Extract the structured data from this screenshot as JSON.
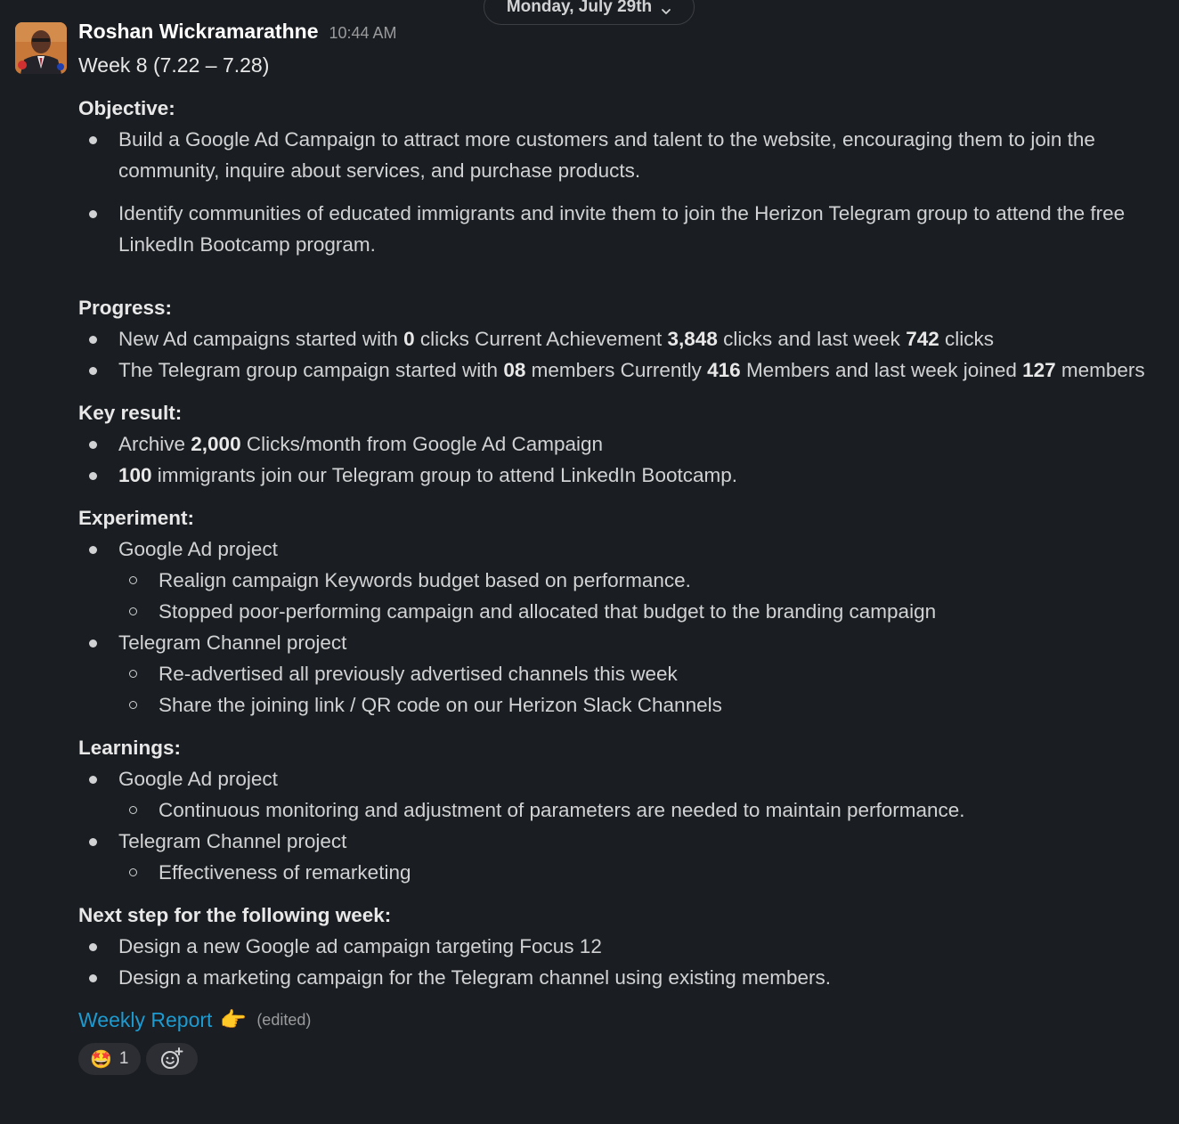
{
  "date_divider": {
    "label": "Monday, July 29th",
    "icon": "chevron-down-icon"
  },
  "message": {
    "sender": "Roshan Wickramarathne",
    "time": "10:44 AM",
    "title": "Week 8 (7.22 – 7.28)",
    "sections": {
      "objective": {
        "heading": "Objective:",
        "items": [
          "Build a Google Ad Campaign to attract more customers and talent to the website, encouraging them to join the community, inquire about services, and purchase products.",
          "Identify communities of educated immigrants and invite them to join the Herizon Telegram group to attend the free LinkedIn Bootcamp program."
        ]
      },
      "progress": {
        "heading": "Progress:",
        "item1": {
          "t1": "New Ad campaigns started with ",
          "b1": "0",
          "t2": " clicks Current Achievement ",
          "b2": "3,848",
          "t3": " clicks and last week ",
          "b3": "742",
          "t4": " clicks"
        },
        "item2": {
          "t1": "The Telegram group campaign started with ",
          "b1": "08",
          "t2": " members Currently ",
          "b2": "416",
          "t3": " Members and last week joined ",
          "b3": "127",
          "t4": " members"
        }
      },
      "key_result": {
        "heading": "Key result:",
        "item1": {
          "t1": "Archive ",
          "b1": "2,000",
          "t2": " Clicks/month from Google Ad Campaign"
        },
        "item2": {
          "b1": "100",
          "t1": " immigrants join our Telegram group to attend LinkedIn Bootcamp."
        }
      },
      "experiment": {
        "heading": "Experiment:",
        "groups": [
          {
            "label": "Google Ad project",
            "subitems": [
              "Realign campaign Keywords budget based on performance.",
              "Stopped poor-performing campaign and allocated that budget to the branding campaign"
            ]
          },
          {
            "label": "Telegram Channel project",
            "subitems": [
              "Re-advertised all previously advertised channels this week",
              "Share the joining link / QR code on our Herizon Slack Channels"
            ]
          }
        ]
      },
      "learnings": {
        "heading": "Learnings:",
        "groups": [
          {
            "label": "Google Ad project",
            "subitems": [
              "Continuous monitoring and adjustment of parameters are needed to maintain performance."
            ]
          },
          {
            "label": "Telegram Channel project",
            "subitems": [
              "Effectiveness of remarketing"
            ]
          }
        ]
      },
      "next_step": {
        "heading": "Next step for the following week:",
        "items": [
          "Design a new Google ad campaign targeting Focus 12",
          "Design a marketing campaign for the Telegram channel using existing members."
        ]
      }
    },
    "footer": {
      "link_text": "Weekly Report",
      "pointing_emoji": "👈",
      "edited_label": "(edited)"
    },
    "reactions": [
      {
        "emoji": "🤩",
        "count": "1"
      }
    ],
    "add_reaction_icon": "add-reaction-icon"
  },
  "colors": {
    "background": "#1a1d21",
    "text": "#d1d2d3",
    "link": "#1d9bd1",
    "muted": "#9a9b9d"
  }
}
